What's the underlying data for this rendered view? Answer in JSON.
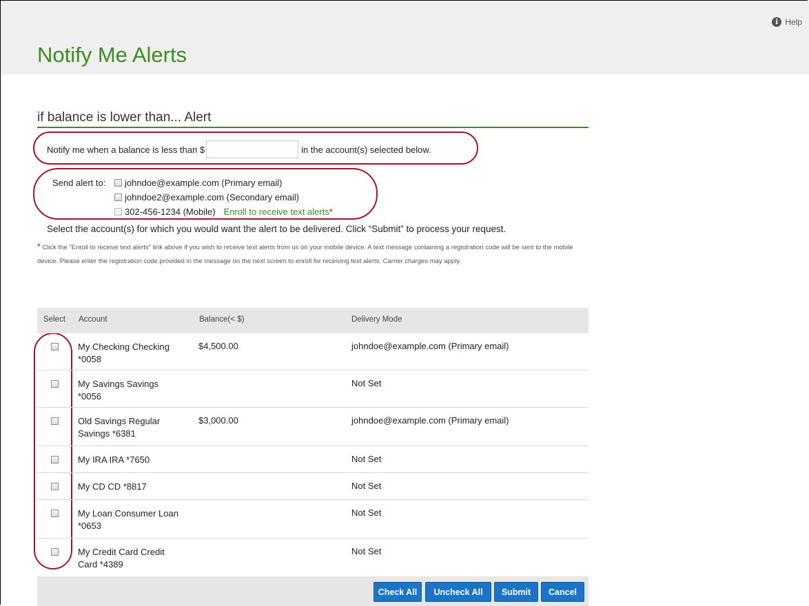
{
  "header": {
    "title": "Notify Me Alerts",
    "help_label": "Help",
    "help_icon": "info-circle-icon"
  },
  "section": {
    "title": "if balance is lower than... Alert"
  },
  "notify": {
    "prefix": "Notify me when a balance is less than $",
    "amount_value": "",
    "suffix": "in the account(s) selected below."
  },
  "send_alert": {
    "label": "Send alert to:",
    "options": [
      {
        "label": "johndoe@example.com (Primary email)",
        "checked": false,
        "disabled": false
      },
      {
        "label": "johndoe2@example.com (Secondary email)",
        "checked": false,
        "disabled": false
      },
      {
        "label": "302-456-1234 (Mobile)",
        "checked": false,
        "disabled": true
      }
    ],
    "enroll_link": "Enroll to receive text alerts",
    "enroll_star": "*"
  },
  "instruction": "Select the account(s) for which you would want the alert to be delivered. Click “Submit” to process your request.",
  "footnote": {
    "star": "*",
    "text": " Click the \"Enroll to receive text alerts\" link above if you wish to receive text alerts from us on your mobile device. A text message containing a registration code will be sent to the mobile device. Please enter the registration code provided in the message on the next screen to enroll for receiving text alerts. Carrier charges may apply."
  },
  "table": {
    "headers": {
      "select": "Select",
      "account": "Account",
      "balance": "Balance(< $)",
      "delivery": "Delivery Mode"
    },
    "rows": [
      {
        "account": "My Checking Checking *0058",
        "balance": "$4,500.00",
        "delivery": "johndoe@example.com (Primary email)"
      },
      {
        "account": "My Savings Savings *0056",
        "balance": "",
        "delivery": "Not Set"
      },
      {
        "account": "Old Savings Regular Savings *6381",
        "balance": "$3,000.00",
        "delivery": "johndoe@example.com (Primary email)"
      },
      {
        "account": "My IRA IRA *7650",
        "balance": "",
        "delivery": "Not Set"
      },
      {
        "account": "My CD CD *8817",
        "balance": "",
        "delivery": "Not Set"
      },
      {
        "account": "My Loan Consumer Loan *0653",
        "balance": "",
        "delivery": "Not Set"
      },
      {
        "account": "My Credit Card Credit Card *4389",
        "balance": "",
        "delivery": "Not Set"
      }
    ]
  },
  "buttons": {
    "check_all": "Check All",
    "uncheck_all": "Uncheck All",
    "submit": "Submit",
    "cancel": "Cancel"
  },
  "colors": {
    "title_green": "#3d8b21",
    "button_blue": "#1b74c5",
    "highlight_ring": "#a0182e",
    "header_bg": "#efefef"
  }
}
